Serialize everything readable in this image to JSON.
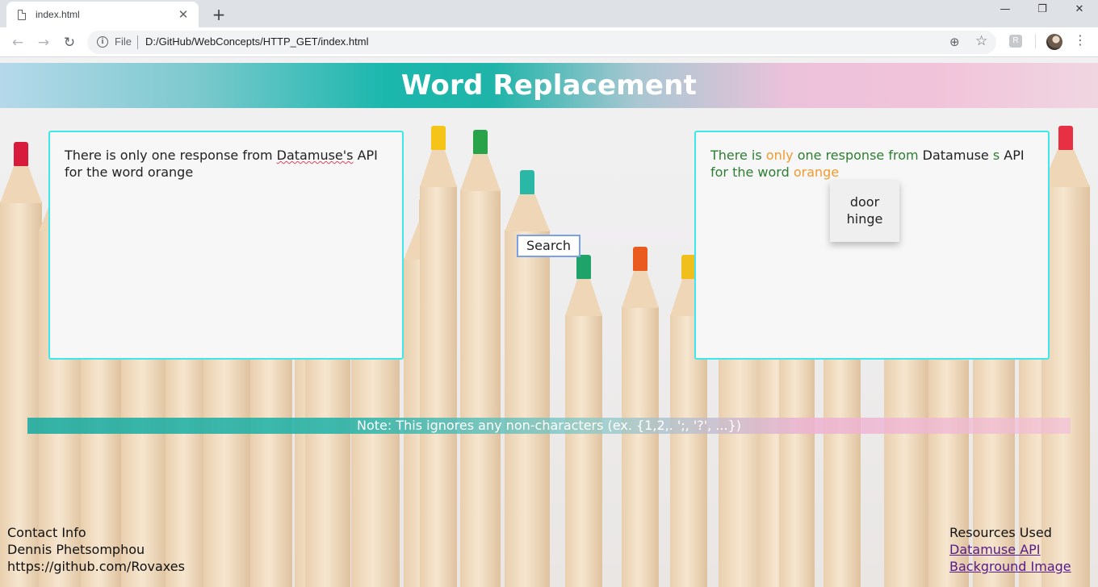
{
  "browser": {
    "tab_title": "index.html",
    "new_tab": "+",
    "close_tab": "✕",
    "security_label": "File",
    "url": "D:/GitHub/WebConcepts/HTTP_GET/index.html",
    "extension_letter": "R",
    "window_controls": {
      "minimize": "—",
      "maximize": "❐",
      "close": "✕"
    }
  },
  "page": {
    "title": "Word Replacement",
    "input_text_part1": "There is only one response from ",
    "input_text_misspelled": "Datamuse's",
    "input_text_part2": " API for the word orange",
    "output_words": [
      {
        "text": "There is ",
        "color": "green"
      },
      {
        "text": "only",
        "color": "orange"
      },
      {
        "text": " one response from ",
        "color": "green"
      },
      {
        "text": "Datamuse",
        "color": "black"
      },
      {
        "text": " s",
        "color": "green"
      },
      {
        "text": " API",
        "color": "black"
      },
      {
        "text": " for the word ",
        "color": "green"
      },
      {
        "text": "orange",
        "color": "orange"
      }
    ],
    "search_button": "Search",
    "suggestions": [
      "door",
      "hinge"
    ],
    "note": "Note: This ignores any non-characters (ex. {1,2,. ';, '?', ...})",
    "contact": {
      "heading": "Contact Info",
      "name": "Dennis Phetsomphou",
      "link": "https://github.com/Rovaxes"
    },
    "resources": {
      "heading": "Resources Used",
      "links": [
        "Datamuse API",
        "Background Image"
      ]
    }
  },
  "colors": {
    "accent_cyan": "#3ee6f0",
    "word_green": "#2e7d32",
    "word_orange": "#f29a2e",
    "link_visited": "#551a8b"
  }
}
